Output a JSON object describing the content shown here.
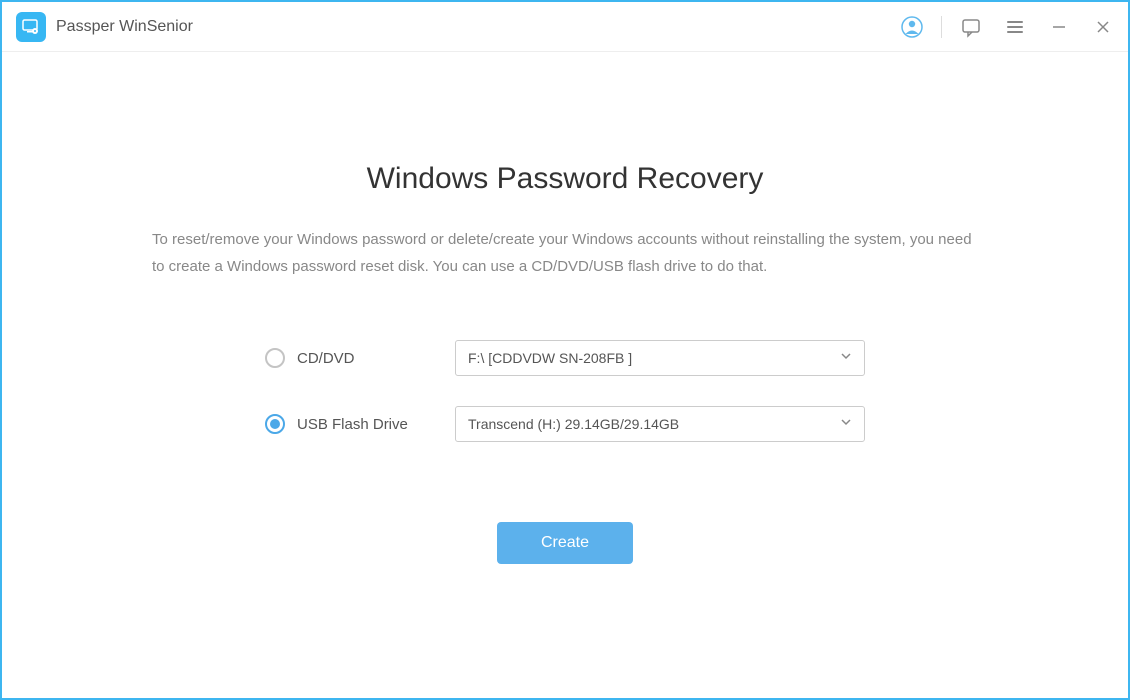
{
  "titlebar": {
    "app_title": "Passper WinSenior"
  },
  "main": {
    "title": "Windows Password Recovery",
    "description": "To reset/remove your Windows password or delete/create your Windows accounts without reinstalling the system, you need to create a Windows password reset disk. You can use a CD/DVD/USB flash drive to do that.",
    "options": {
      "cd": {
        "label": "CD/DVD",
        "selected": false,
        "value": "F:\\ [CDDVDW SN-208FB ]"
      },
      "usb": {
        "label": "USB Flash Drive",
        "selected": true,
        "value": "Transcend (H:) 29.14GB/29.14GB"
      }
    },
    "create_button": "Create"
  }
}
